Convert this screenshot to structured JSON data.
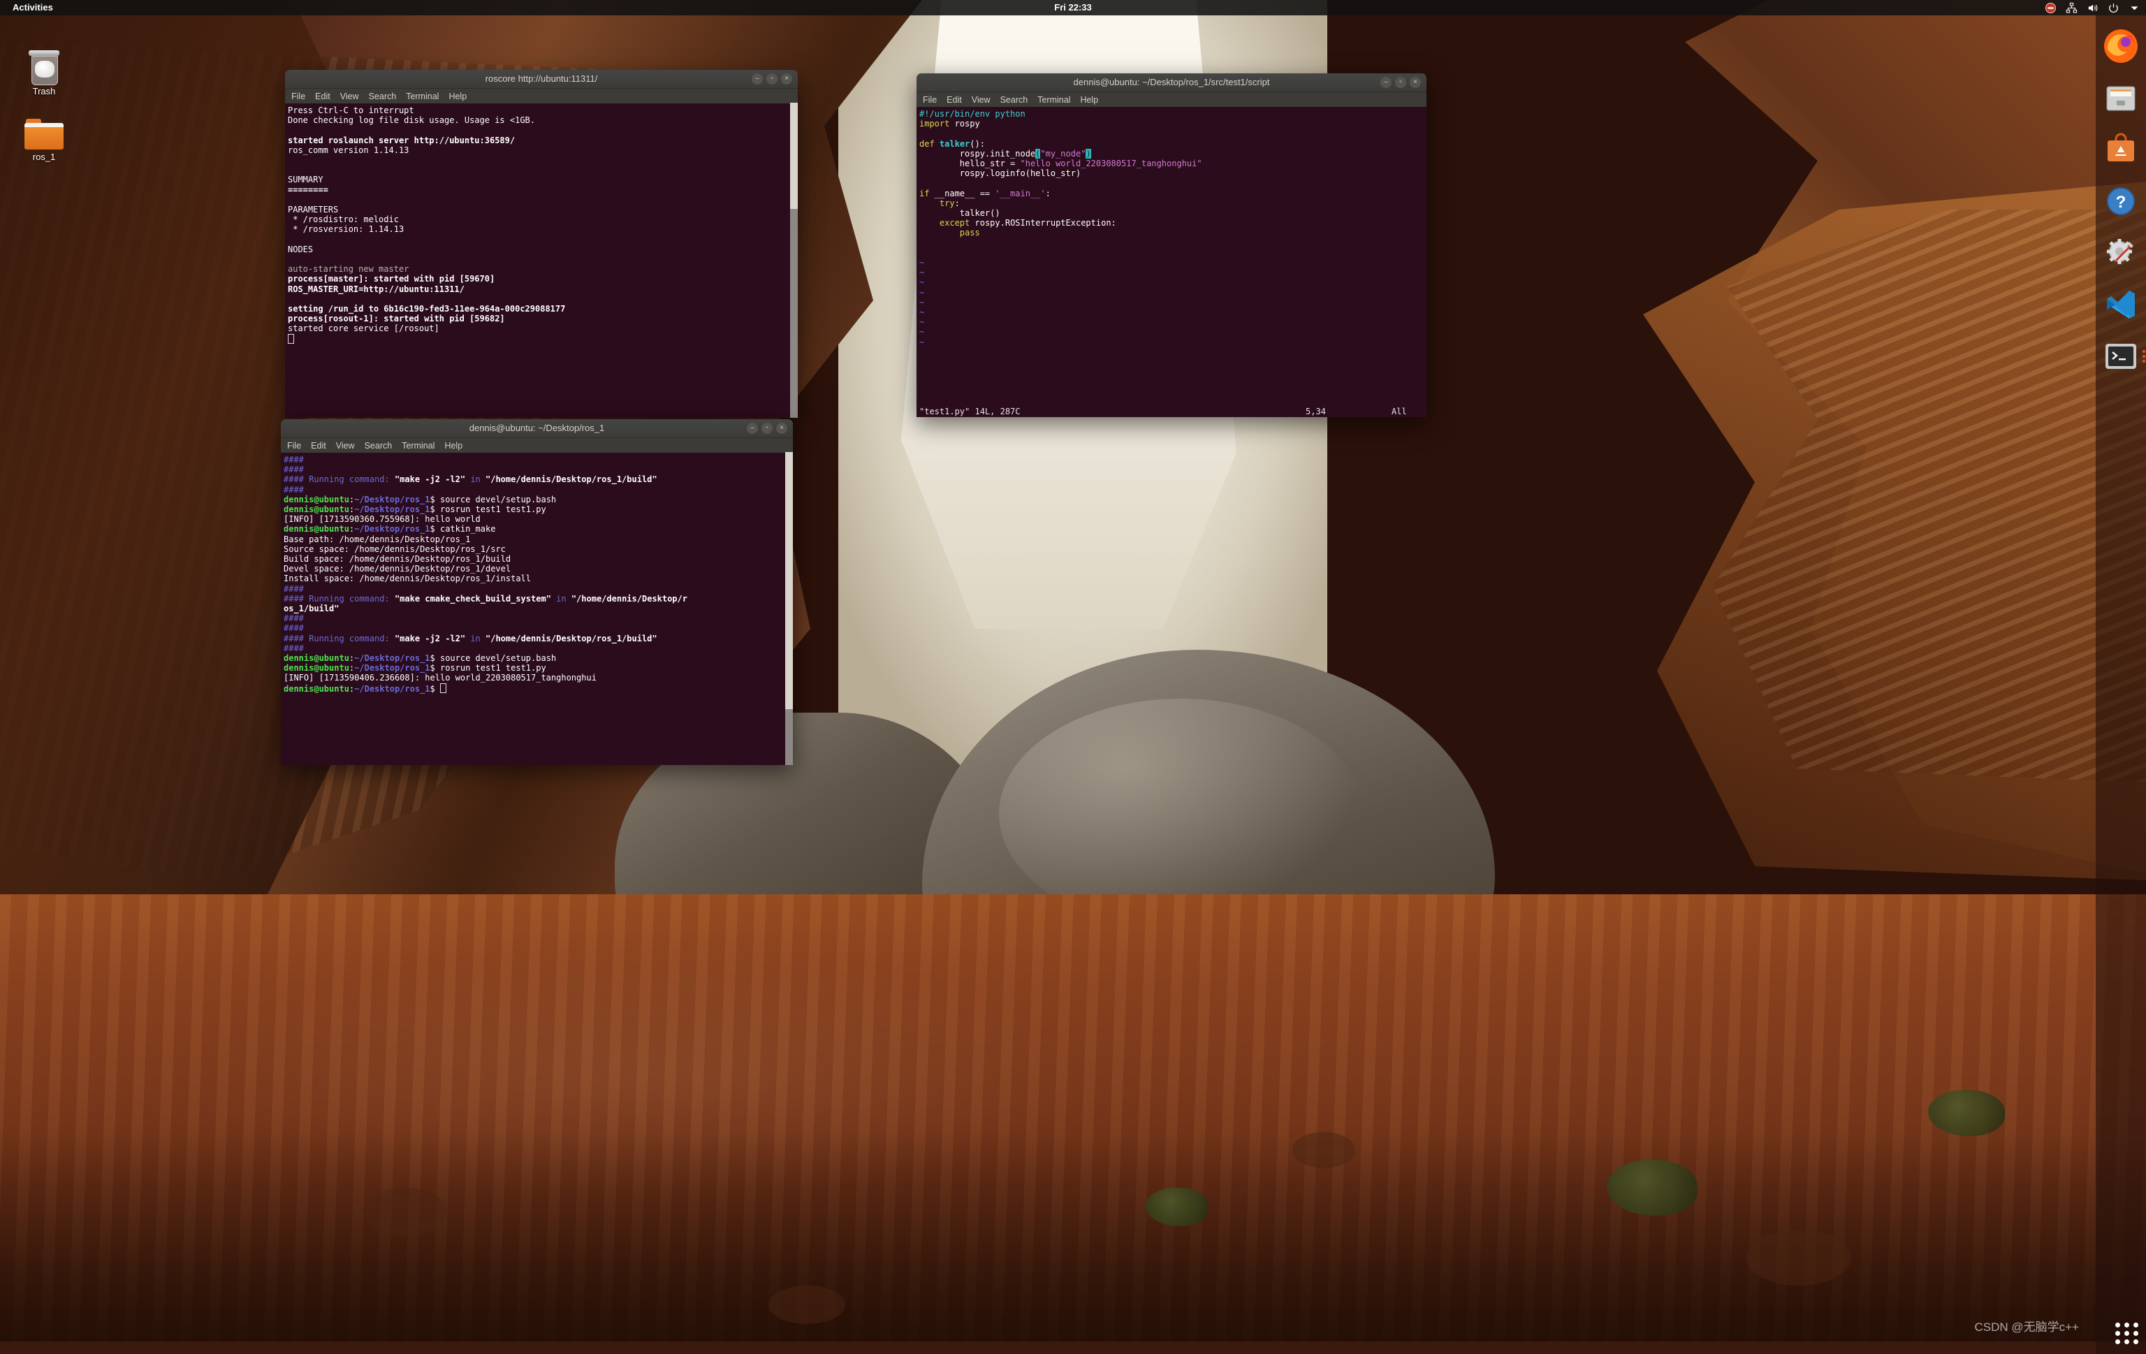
{
  "panel": {
    "activities": "Activities",
    "clock": "Fri 22:33",
    "tray": [
      {
        "name": "do-not-disturb-icon",
        "glyph": "⛔"
      },
      {
        "name": "network-icon",
        "glyph": "🖧"
      },
      {
        "name": "volume-icon",
        "glyph": "🔊"
      },
      {
        "name": "power-icon",
        "glyph": "⏻"
      },
      {
        "name": "chevron-down-icon",
        "glyph": "▾"
      }
    ]
  },
  "desktop_icons": [
    {
      "name": "trash",
      "label": "Trash"
    },
    {
      "name": "folder-ros_1",
      "label": "ros_1"
    }
  ],
  "dock": {
    "items": [
      {
        "name": "dock-firefox",
        "label": "Firefox"
      },
      {
        "name": "dock-files",
        "label": "Files"
      },
      {
        "name": "dock-ubuntu-software",
        "label": "Ubuntu Software"
      },
      {
        "name": "dock-help",
        "label": "Help"
      },
      {
        "name": "dock-settings",
        "label": "Settings"
      },
      {
        "name": "dock-vscode",
        "label": "Visual Studio Code"
      },
      {
        "name": "dock-terminal",
        "label": "Terminal"
      }
    ],
    "show_apps_label": "Show Applications"
  },
  "watermark": "CSDN @无脑学c++",
  "menus": [
    "File",
    "Edit",
    "View",
    "Search",
    "Terminal",
    "Help"
  ],
  "window_buttons": {
    "minimize": "–",
    "maximize": "▫",
    "close": "×"
  },
  "windows": {
    "roscore": {
      "title": "roscore http://ubuntu:11311/",
      "lines": [
        [
          {
            "t": "Press Ctrl-C to interrupt",
            "c": "white"
          }
        ],
        [
          {
            "t": "Done checking log file disk usage. Usage is <1GB.",
            "c": "white"
          }
        ],
        [
          {
            "t": "",
            "c": "white"
          }
        ],
        [
          {
            "t": "started roslaunch server http://ubuntu:36589/",
            "c": "white b"
          }
        ],
        [
          {
            "t": "ros_comm version 1.14.13",
            "c": "white"
          }
        ],
        [
          {
            "t": "",
            "c": "white"
          }
        ],
        [
          {
            "t": "",
            "c": "white"
          }
        ],
        [
          {
            "t": "SUMMARY",
            "c": "white"
          }
        ],
        [
          {
            "t": "========",
            "c": "white b"
          }
        ],
        [
          {
            "t": "",
            "c": "white"
          }
        ],
        [
          {
            "t": "PARAMETERS",
            "c": "white"
          }
        ],
        [
          {
            "t": " * /rosdistro: melodic",
            "c": "white"
          }
        ],
        [
          {
            "t": " * /rosversion: 1.14.13",
            "c": "white"
          }
        ],
        [
          {
            "t": "",
            "c": "white"
          }
        ],
        [
          {
            "t": "NODES",
            "c": "white"
          }
        ],
        [
          {
            "t": "",
            "c": "white"
          }
        ],
        [
          {
            "t": "auto-starting new master",
            "c": "grey"
          }
        ],
        [
          {
            "t": "process[master]: started with pid [59670]",
            "c": "white b"
          }
        ],
        [
          {
            "t": "ROS_MASTER_URI=http://ubuntu:11311/",
            "c": "white b"
          }
        ],
        [
          {
            "t": "",
            "c": "white"
          }
        ],
        [
          {
            "t": "setting /run_id to 6b16c190-fed3-11ee-964a-000c29088177",
            "c": "white b"
          }
        ],
        [
          {
            "t": "process[rosout-1]: started with pid [59682]",
            "c": "white b"
          }
        ],
        [
          {
            "t": "started core service [/rosout]",
            "c": "white"
          }
        ],
        [
          {
            "t": "",
            "c": "cursor"
          }
        ]
      ]
    },
    "editor": {
      "title": "dennis@ubuntu: ~/Desktop/ros_1/src/test1/script",
      "lines": [
        [
          {
            "t": "#!/usr/bin/env python",
            "c": "cyan"
          }
        ],
        [
          {
            "t": "import",
            "c": "yellow"
          },
          {
            "t": " rospy",
            "c": "white"
          }
        ],
        [
          {
            "t": "",
            "c": "white"
          }
        ],
        [
          {
            "t": "def",
            "c": "yellow"
          },
          {
            "t": " ",
            "c": "white"
          },
          {
            "t": "talker",
            "c": "cyan b"
          },
          {
            "t": "():",
            "c": "white"
          }
        ],
        [
          {
            "t": "        rospy.init_node",
            "c": "white"
          },
          {
            "t": "(",
            "c": "sel"
          },
          {
            "t": "\"my_node\"",
            "c": "mag"
          },
          {
            "t": ")",
            "c": "sel"
          }
        ],
        [
          {
            "t": "        hello_str = ",
            "c": "white"
          },
          {
            "t": "\"hello world_2203080517_tanghonghui\"",
            "c": "mag"
          }
        ],
        [
          {
            "t": "        rospy.loginfo(hello_str)",
            "c": "white"
          }
        ],
        [
          {
            "t": "",
            "c": "white"
          }
        ],
        [
          {
            "t": "if",
            "c": "yellow"
          },
          {
            "t": " __name__ == ",
            "c": "white"
          },
          {
            "t": "'__main__'",
            "c": "mag"
          },
          {
            "t": ":",
            "c": "white"
          }
        ],
        [
          {
            "t": "    ",
            "c": "white"
          },
          {
            "t": "try",
            "c": "yellow"
          },
          {
            "t": ":",
            "c": "white"
          }
        ],
        [
          {
            "t": "        talker()",
            "c": "white"
          }
        ],
        [
          {
            "t": "    ",
            "c": "white"
          },
          {
            "t": "except",
            "c": "yellow"
          },
          {
            "t": " rospy.ROSInterruptException:",
            "c": "white"
          }
        ],
        [
          {
            "t": "        ",
            "c": "white"
          },
          {
            "t": "pass",
            "c": "yellow"
          }
        ],
        [
          {
            "t": "",
            "c": "white"
          }
        ],
        [
          {
            "t": "",
            "c": "white"
          }
        ],
        [
          {
            "t": "~",
            "c": "blue"
          }
        ],
        [
          {
            "t": "~",
            "c": "blue"
          }
        ],
        [
          {
            "t": "~",
            "c": "blue"
          }
        ],
        [
          {
            "t": "~",
            "c": "blue"
          }
        ],
        [
          {
            "t": "~",
            "c": "blue"
          }
        ],
        [
          {
            "t": "~",
            "c": "blue"
          }
        ],
        [
          {
            "t": "~",
            "c": "blue"
          }
        ],
        [
          {
            "t": "~",
            "c": "blue"
          }
        ],
        [
          {
            "t": "~",
            "c": "blue"
          }
        ]
      ],
      "status": {
        "file": "\"test1.py\" 14L, 287C",
        "position": "5,34",
        "scroll": "All"
      }
    },
    "terminal": {
      "title": "dennis@ubuntu: ~/Desktop/ros_1",
      "lines": [
        [
          {
            "t": "####",
            "c": "blue"
          }
        ],
        [
          {
            "t": "####",
            "c": "blue"
          }
        ],
        [
          {
            "t": "#### Running command:",
            "c": "blue"
          },
          {
            "t": " \"make -j2 -l2\" ",
            "c": "white b"
          },
          {
            "t": "in",
            "c": "blue"
          },
          {
            "t": " \"/home/dennis/Desktop/ros_1/build\"",
            "c": "white b"
          }
        ],
        [
          {
            "t": "####",
            "c": "blue"
          }
        ],
        [
          {
            "t": "dennis@ubuntu",
            "c": "green-b"
          },
          {
            "t": ":",
            "c": "white"
          },
          {
            "t": "~/Desktop/ros_1",
            "c": "blue b"
          },
          {
            "t": "$ source devel/setup.bash",
            "c": "white"
          }
        ],
        [
          {
            "t": "dennis@ubuntu",
            "c": "green-b"
          },
          {
            "t": ":",
            "c": "white"
          },
          {
            "t": "~/Desktop/ros_1",
            "c": "blue b"
          },
          {
            "t": "$ rosrun test1 test1.py",
            "c": "white"
          }
        ],
        [
          {
            "t": "[INFO] [1713590360.755968]: hello world",
            "c": "white"
          }
        ],
        [
          {
            "t": "dennis@ubuntu",
            "c": "green-b"
          },
          {
            "t": ":",
            "c": "white"
          },
          {
            "t": "~/Desktop/ros_1",
            "c": "blue b"
          },
          {
            "t": "$ catkin_make",
            "c": "white"
          }
        ],
        [
          {
            "t": "Base path: /home/dennis/Desktop/ros_1",
            "c": "white"
          }
        ],
        [
          {
            "t": "Source space: /home/dennis/Desktop/ros_1/src",
            "c": "white"
          }
        ],
        [
          {
            "t": "Build space: /home/dennis/Desktop/ros_1/build",
            "c": "white"
          }
        ],
        [
          {
            "t": "Devel space: /home/dennis/Desktop/ros_1/devel",
            "c": "white"
          }
        ],
        [
          {
            "t": "Install space: /home/dennis/Desktop/ros_1/install",
            "c": "white"
          }
        ],
        [
          {
            "t": "####",
            "c": "blue"
          }
        ],
        [
          {
            "t": "#### Running command:",
            "c": "blue"
          },
          {
            "t": " \"make cmake_check_build_system\" ",
            "c": "white b"
          },
          {
            "t": "in",
            "c": "blue"
          },
          {
            "t": " \"/home/dennis/Desktop/r",
            "c": "white b"
          }
        ],
        [
          {
            "t": "os_1/build\"",
            "c": "white b"
          }
        ],
        [
          {
            "t": "####",
            "c": "blue"
          }
        ],
        [
          {
            "t": "####",
            "c": "blue"
          }
        ],
        [
          {
            "t": "#### Running command:",
            "c": "blue"
          },
          {
            "t": " \"make -j2 -l2\" ",
            "c": "white b"
          },
          {
            "t": "in",
            "c": "blue"
          },
          {
            "t": " \"/home/dennis/Desktop/ros_1/build\"",
            "c": "white b"
          }
        ],
        [
          {
            "t": "####",
            "c": "blue"
          }
        ],
        [
          {
            "t": "dennis@ubuntu",
            "c": "green-b"
          },
          {
            "t": ":",
            "c": "white"
          },
          {
            "t": "~/Desktop/ros_1",
            "c": "blue b"
          },
          {
            "t": "$ source devel/setup.bash",
            "c": "white"
          }
        ],
        [
          {
            "t": "dennis@ubuntu",
            "c": "green-b"
          },
          {
            "t": ":",
            "c": "white"
          },
          {
            "t": "~/Desktop/ros_1",
            "c": "blue b"
          },
          {
            "t": "$ rosrun test1 test1.py",
            "c": "white"
          }
        ],
        [
          {
            "t": "[INFO] [1713590406.236608]: hello world_2203080517_tanghonghui",
            "c": "white"
          }
        ],
        [
          {
            "t": "dennis@ubuntu",
            "c": "green-b"
          },
          {
            "t": ":",
            "c": "white"
          },
          {
            "t": "~/Desktop/ros_1",
            "c": "blue b"
          },
          {
            "t": "$ ",
            "c": "white"
          },
          {
            "t": "",
            "c": "cursor"
          }
        ]
      ]
    }
  },
  "colors": {
    "terminal_bg": "#2b0c1c",
    "titlebar": "#3c3b37",
    "accent": "#e95420"
  }
}
